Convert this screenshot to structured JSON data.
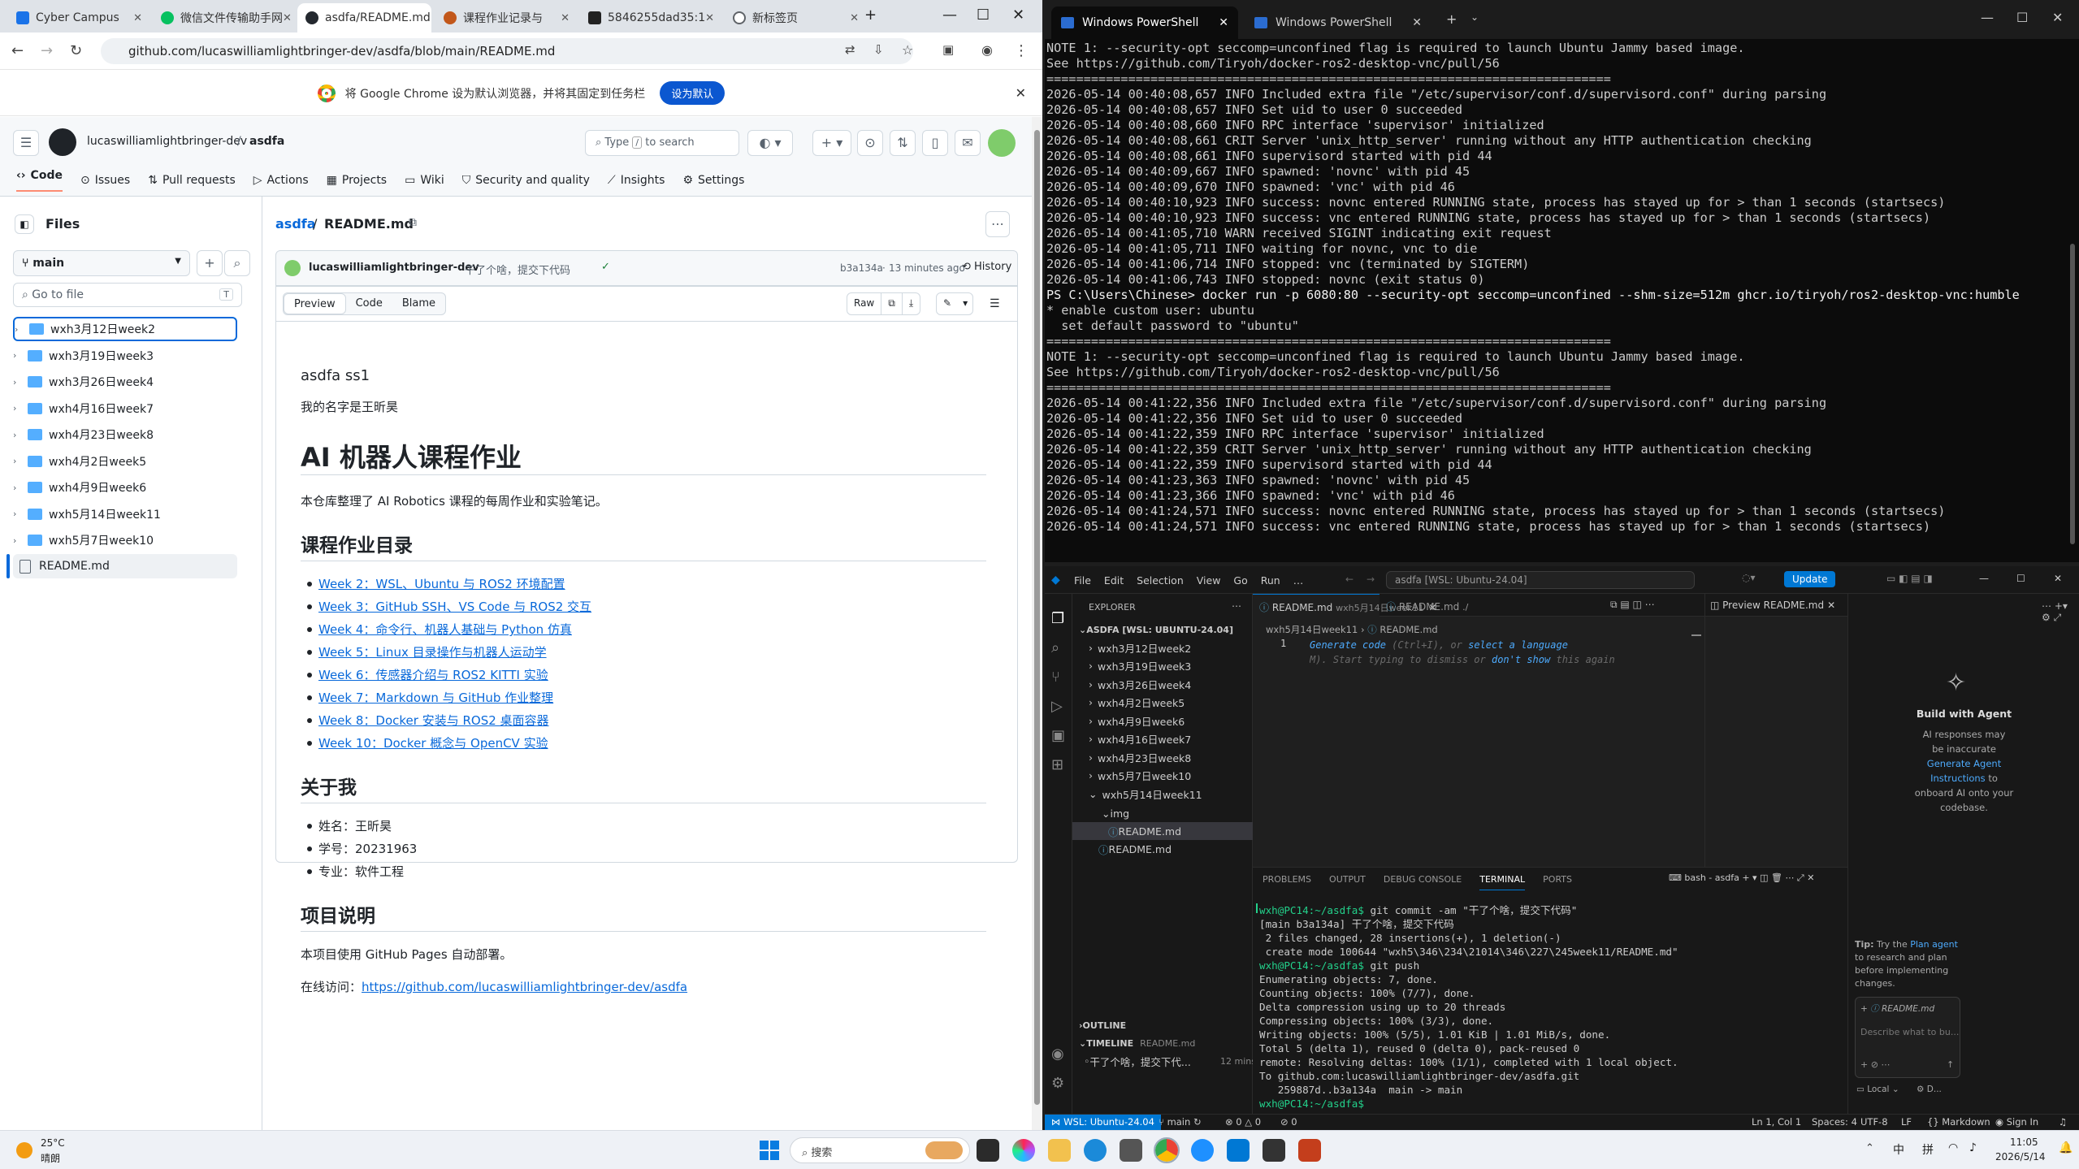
{
  "chrome": {
    "tabs": [
      {
        "label": "Cyber Campus",
        "color": "#1a73e8"
      },
      {
        "label": "微信文件传输助手网",
        "color": "#07c160"
      },
      {
        "label": "asdfa/README.md",
        "color": "#24292f"
      },
      {
        "label": "课程作业记录与",
        "color": "#c2571a"
      },
      {
        "label": "5846255dad35:1",
        "color": "#222222"
      },
      {
        "label": "新标签页",
        "color": "#5f6368"
      }
    ],
    "url": "github.com/lucaswilliamlightbringer-dev/asdfa/blob/main/README.md",
    "infobar_text": "将 Google Chrome 设为默认浏览器，并将其固定到任务栏",
    "infobar_button": "设为默认"
  },
  "github": {
    "owner": "lucaswilliamlightbringer-dev",
    "repo": "asdfa",
    "search_placeholder_before": "Type",
    "search_key": "/",
    "search_placeholder_after": "to search",
    "tabs": [
      "Code",
      "Issues",
      "Pull requests",
      "Actions",
      "Projects",
      "Wiki",
      "Security and quality",
      "Insights",
      "Settings"
    ],
    "files_title": "Files",
    "branch": "main",
    "go_to_file": "Go to file",
    "go_to_file_key": "T",
    "tree": [
      "wxh3月12日week2",
      "wxh3月19日week3",
      "wxh3月26日week4",
      "wxh4月16日week7",
      "wxh4月23日week8",
      "wxh4月2日week5",
      "wxh4月9日week6",
      "wxh5月14日week11",
      "wxh5月7日week10"
    ],
    "tree_file": "README.md",
    "breadcrumb_repo": "asdfa",
    "breadcrumb_file": "README.md",
    "commit": {
      "author": "lucaswilliamlightbringer-dev",
      "message": "干了个啥，提交下代码",
      "sha": "b3a134a",
      "time": "13 minutes ago",
      "history": "History"
    },
    "view_tabs": [
      "Preview",
      "Code",
      "Blame"
    ],
    "raw": "Raw",
    "readme": {
      "title": "asdfa ss1",
      "intro": "我的名字是王昕昊",
      "h1": "AI 机器人课程作业",
      "desc": "本仓库整理了 AI Robotics 课程的每周作业和实验笔记。",
      "h2_list": "课程作业目录",
      "weeks": [
        "Week 2：WSL、Ubuntu 与 ROS2 环境配置",
        "Week 3：GitHub SSH、VS Code 与 ROS2 交互",
        "Week 4：命令行、机器人基础与 Python 仿真",
        "Week 5：Linux 目录操作与机器人运动学",
        "Week 6：传感器介绍与 ROS2 KITTI 实验",
        "Week 7：Markdown 与 GitHub 作业整理",
        "Week 8：Docker 安装与 ROS2 桌面容器",
        "Week 10：Docker 概念与 OpenCV 实验"
      ],
      "h2_about": "关于我",
      "about": [
        "姓名：王昕昊",
        "学号：20231963",
        "专业：软件工程"
      ],
      "h2_project": "项目说明",
      "project_desc": "本项目使用 GitHub Pages 自动部署。",
      "visit_label": "在线访问：",
      "visit_link": "https://github.com/lucaswilliamlightbringer-dev/asdfa"
    }
  },
  "powershell": {
    "tabs": [
      "Windows PowerShell",
      "Windows PowerShell"
    ],
    "lines": [
      "NOTE 1: --security-opt seccomp=unconfined flag is required to launch Ubuntu Jammy based image.",
      "See https://github.com/Tiryoh/docker-ros2-desktop-vnc/pull/56",
      "============================================================================",
      "2026-05-14 00:40:08,657 INFO Included extra file \"/etc/supervisor/conf.d/supervisord.conf\" during parsing",
      "2026-05-14 00:40:08,657 INFO Set uid to user 0 succeeded",
      "2026-05-14 00:40:08,660 INFO RPC interface 'supervisor' initialized",
      "2026-05-14 00:40:08,661 CRIT Server 'unix_http_server' running without any HTTP authentication checking",
      "2026-05-14 00:40:08,661 INFO supervisord started with pid 44",
      "2026-05-14 00:40:09,667 INFO spawned: 'novnc' with pid 45",
      "2026-05-14 00:40:09,670 INFO spawned: 'vnc' with pid 46",
      "2026-05-14 00:40:10,923 INFO success: novnc entered RUNNING state, process has stayed up for > than 1 seconds (startsecs)",
      "2026-05-14 00:40:10,923 INFO success: vnc entered RUNNING state, process has stayed up for > than 1 seconds (startsecs)",
      "2026-05-14 00:41:05,710 WARN received SIGINT indicating exit request",
      "2026-05-14 00:41:05,711 INFO waiting for novnc, vnc to die",
      "2026-05-14 00:41:06,714 INFO stopped: vnc (terminated by SIGTERM)",
      "2026-05-14 00:41:06,743 INFO stopped: novnc (exit status 0)",
      "PS C:\\Users\\Chinese> docker run -p 6080:80 --security-opt seccomp=unconfined --shm-size=512m ghcr.io/tiryoh/ros2-desktop-vnc:humble",
      "* enable custom user: ubuntu",
      "  set default password to \"ubuntu\"",
      "============================================================================",
      "NOTE 1: --security-opt seccomp=unconfined flag is required to launch Ubuntu Jammy based image.",
      "See https://github.com/Tiryoh/docker-ros2-desktop-vnc/pull/56",
      "============================================================================",
      "2026-05-14 00:41:22,356 INFO Included extra file \"/etc/supervisor/conf.d/supervisord.conf\" during parsing",
      "2026-05-14 00:41:22,356 INFO Set uid to user 0 succeeded",
      "2026-05-14 00:41:22,359 INFO RPC interface 'supervisor' initialized",
      "2026-05-14 00:41:22,359 CRIT Server 'unix_http_server' running without any HTTP authentication checking",
      "2026-05-14 00:41:22,359 INFO supervisord started with pid 44",
      "2026-05-14 00:41:23,363 INFO spawned: 'novnc' with pid 45",
      "2026-05-14 00:41:23,366 INFO spawned: 'vnc' with pid 46",
      "2026-05-14 00:41:24,571 INFO success: novnc entered RUNNING state, process has stayed up for > than 1 seconds (startsecs)",
      "2026-05-14 00:41:24,571 INFO success: vnc entered RUNNING state, process has stayed up for > than 1 seconds (startsecs)"
    ]
  },
  "vscode": {
    "menu": [
      "File",
      "Edit",
      "Selection",
      "View",
      "Go",
      "Run",
      "…"
    ],
    "title": "asdfa [WSL: Ubuntu-24.04]",
    "update": "Update",
    "explorer": "EXPLORER",
    "workspace": "ASDFA [WSL: UBUNTU-24.04]",
    "folders": [
      "wxh3月12日week2",
      "wxh3月19日week3",
      "wxh3月26日week4",
      "wxh4月2日week5",
      "wxh4月9日week6",
      "wxh4月16日week7",
      "wxh4月23日week8",
      "wxh5月7日week10",
      "wxh5月14日week11"
    ],
    "subfolder": "img",
    "active_file": "README.md",
    "root_file": "README.md",
    "outline": "OUTLINE",
    "timeline": "TIMELINE",
    "timeline_file": "README.md",
    "timeline_entry": "干了个啥，提交下代...",
    "timeline_time": "12 mins",
    "editor_tabs": [
      {
        "label": "README.md",
        "path": "wxh5月14日week11"
      },
      {
        "label": "README.md",
        "path": "./"
      }
    ],
    "breadcrumb": [
      "wxh5月14日week11",
      "README.md"
    ],
    "line_number": "1",
    "hint_generate": "Generate code",
    "hint_shortcut": "(Ctrl+I), or",
    "hint_select": "select a language",
    "hint_line2": "M). Start typing to dismiss or",
    "hint_dont": "don't show",
    "hint_end": "this again",
    "preview_tab": "Preview README.md",
    "panel_tabs": [
      "PROBLEMS",
      "OUTPUT",
      "DEBUG CONSOLE",
      "TERMINAL",
      "PORTS"
    ],
    "terminal_name": "bash - asdfa",
    "terminal_lines": [
      "wxh@PC14:~/asdfa$ git commit -am \"干了个啥，提交下代码\"",
      "[main b3a134a] 干了个啥，提交下代码",
      " 2 files changed, 28 insertions(+), 1 deletion(-)",
      " create mode 100644 \"wxh5\\346\\234\\21014\\346\\227\\245week11/README.md\"",
      "wxh@PC14:~/asdfa$ git push",
      "Enumerating objects: 7, done.",
      "Counting objects: 100% (7/7), done.",
      "Delta compression using up to 20 threads",
      "Compressing objects: 100% (3/3), done.",
      "Writing objects: 100% (5/5), 1.01 KiB | 1.01 MiB/s, done.",
      "Total 5 (delta 1), reused 0 (delta 0), pack-reused 0",
      "remote: Resolving deltas: 100% (1/1), completed with 1 local object.",
      "To github.com:lucaswilliamlightbringer-dev/asdfa.git",
      "   259887d..b3a134a  main -> main",
      "wxh@PC14:~/asdfa$ "
    ],
    "chat": {
      "title": "Build with Agent",
      "desc1": "AI responses may",
      "desc2": "be inaccurate",
      "link1": "Generate Agent",
      "link2": "Instructions",
      "desc3": "to",
      "desc4": "onboard AI onto your",
      "desc5": "codebase.",
      "tip_label": "Tip:",
      "tip_text1": "Try the",
      "tip_link": "Plan agent",
      "tip_text2": "to research and plan",
      "tip_text3": "before implementing",
      "tip_text4": "changes.",
      "context_file": "README.md",
      "input_placeholder": "Describe what to bu...",
      "local": "Local",
      "d": "D..."
    },
    "status": {
      "remote": "WSL: Ubuntu-24.04",
      "branch": "main",
      "problems": "0 △ 0",
      "ports": "0",
      "position": "Ln 1, Col 1",
      "spaces": "Spaces: 4",
      "encoding": "UTF-8",
      "eol": "LF",
      "lang": "Markdown",
      "signin": "Sign In"
    }
  },
  "taskbar": {
    "weather_temp": "25°C",
    "weather_desc": "晴朗",
    "search": "搜索",
    "ime1": "中",
    "ime2": "拼",
    "time": "11:05",
    "date": "2026/5/14"
  },
  "colors": {
    "github_link": "#0969da",
    "vscode_blue": "#0078d4",
    "terminal_green": "#23d18b",
    "accent_orange": "#fd8c73"
  }
}
